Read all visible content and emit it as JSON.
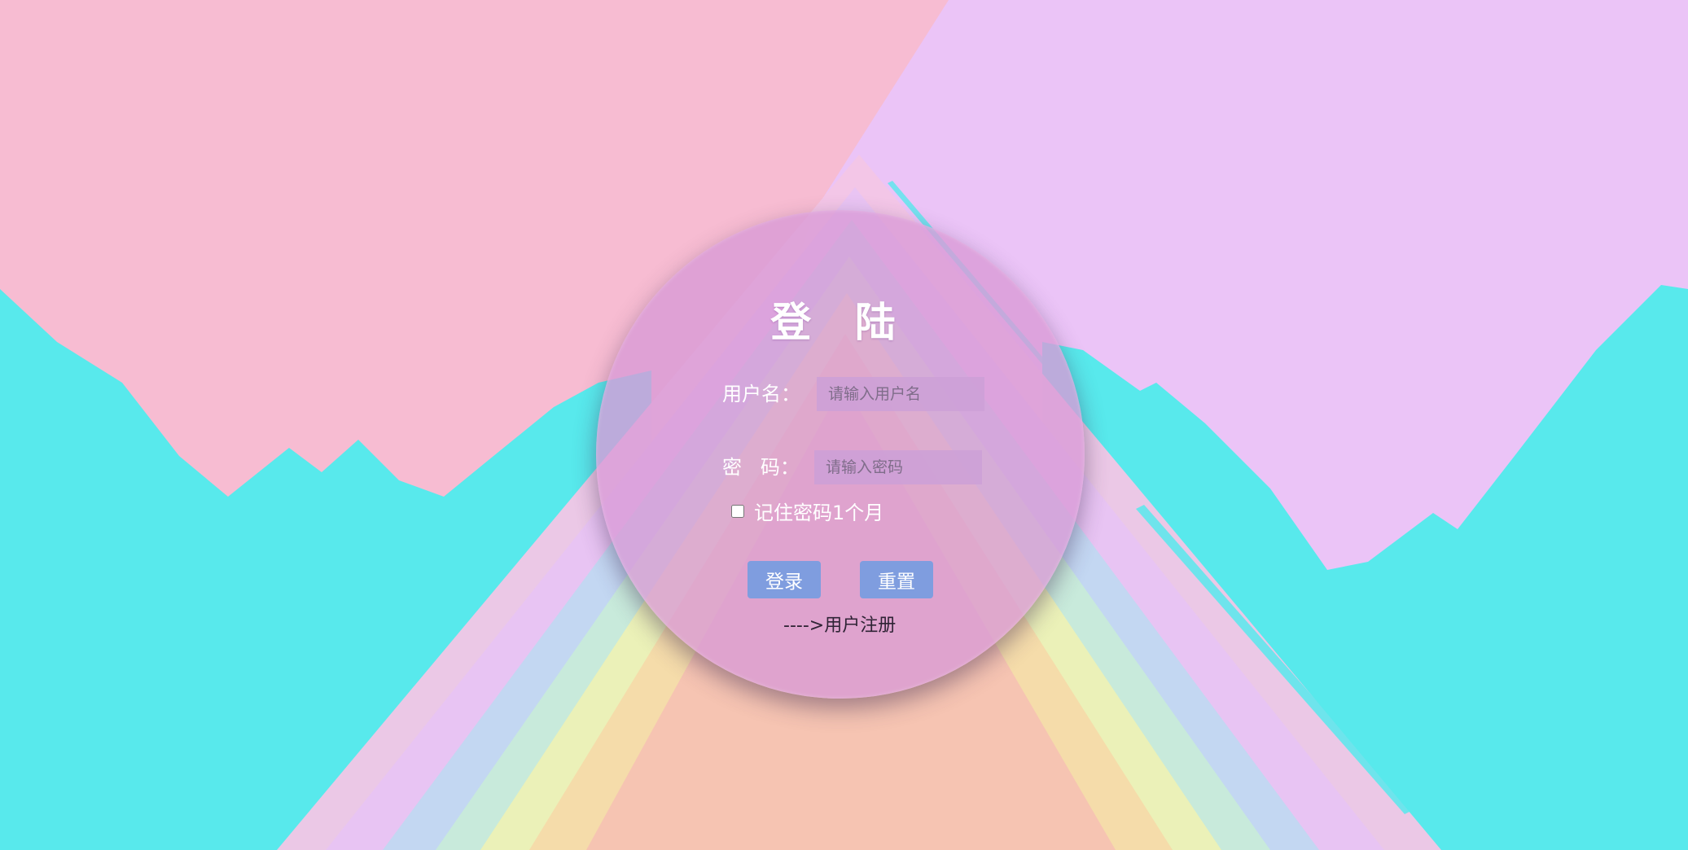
{
  "login": {
    "title": "登 陆",
    "username_label": "用户名：",
    "username_placeholder": "请输入用户名",
    "password_label": "密   码：",
    "password_placeholder": "请输入密码",
    "remember_label": "记住密码1个月",
    "login_button": "登录",
    "reset_button": "重置",
    "register_link": "---->用户注册"
  },
  "colors": {
    "background_pink": "#f7bcd2",
    "background_lavender": "#ebc4f7",
    "mountain_cyan": "#58e9ec",
    "circle_fill": "#d89ad6",
    "button_blue": "#7f9ddf",
    "text_white": "#ffffff"
  }
}
